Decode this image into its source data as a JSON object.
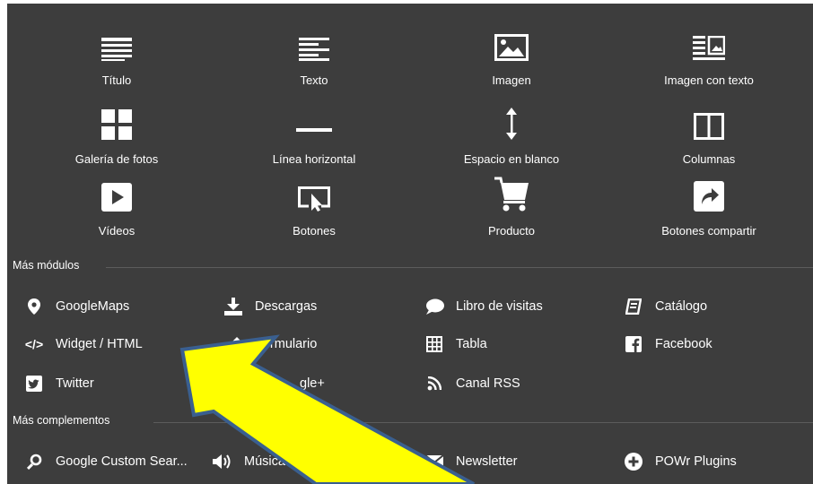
{
  "grid": [
    {
      "label": "Título",
      "icon": "title-lines-icon"
    },
    {
      "label": "Texto",
      "icon": "text-lines-icon"
    },
    {
      "label": "Imagen",
      "icon": "image-icon"
    },
    {
      "label": "Imagen con texto",
      "icon": "image-with-text-icon"
    },
    {
      "label": "Galería de fotos",
      "icon": "gallery-grid-icon"
    },
    {
      "label": "Línea horizontal",
      "icon": "horizontal-line-icon"
    },
    {
      "label": "Espacio en blanco",
      "icon": "vertical-arrows-icon"
    },
    {
      "label": "Columnas",
      "icon": "columns-icon"
    },
    {
      "label": "Vídeos",
      "icon": "play-icon"
    },
    {
      "label": "Botones",
      "icon": "button-cursor-icon"
    },
    {
      "label": "Producto",
      "icon": "shopping-cart-icon"
    },
    {
      "label": "Botones compartir",
      "icon": "share-icon"
    }
  ],
  "more_modules": {
    "title": "Más módulos",
    "items": [
      {
        "label": "GoogleMaps",
        "icon": "map-pin-icon"
      },
      {
        "label": "Descargas",
        "icon": "download-icon"
      },
      {
        "label": "Libro de visitas",
        "icon": "speech-bubble-icon"
      },
      {
        "label": "Catálogo",
        "icon": "catalog-book-icon"
      },
      {
        "label": "Widget / HTML",
        "icon": "code-icon"
      },
      {
        "label": "Formulario",
        "icon": "form-pencil-icon"
      },
      {
        "label": "Tabla",
        "icon": "table-icon"
      },
      {
        "label": "Facebook",
        "icon": "facebook-icon"
      },
      {
        "label": "Twitter",
        "icon": "twitter-icon"
      },
      {
        "label": "gle+",
        "icon": "google-plus-icon"
      },
      {
        "label": "Canal RSS",
        "icon": "rss-icon"
      }
    ]
  },
  "more_addons": {
    "title": "Más complementos",
    "items": [
      {
        "label": "Google Custom Sear...",
        "icon": "search-icon"
      },
      {
        "label": "Música",
        "icon": "speaker-icon"
      },
      {
        "label": "Newsletter",
        "icon": "envelope-icon"
      },
      {
        "label": "POWr Plugins",
        "icon": "plus-circle-icon"
      }
    ]
  },
  "colors": {
    "panel_bg": "#3d3d3d",
    "text": "#ffffff",
    "divider": "#5c5c5c",
    "arrow_fill": "#ffff00",
    "arrow_stroke": "#3a5f8f"
  }
}
